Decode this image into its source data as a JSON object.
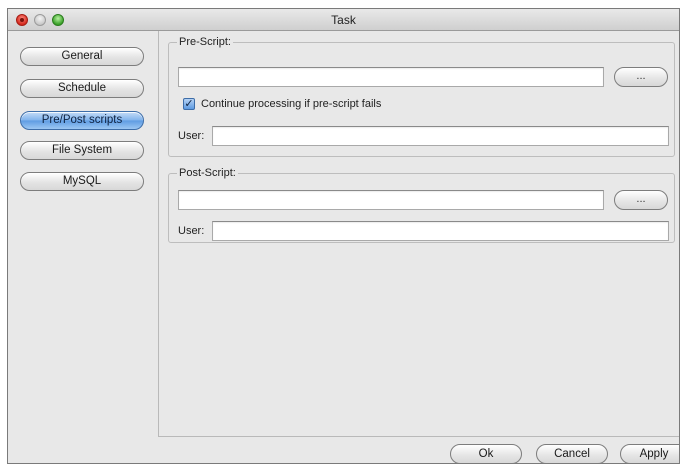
{
  "window": {
    "title": "Task"
  },
  "sidebar": {
    "items": [
      {
        "label": "General",
        "active": false
      },
      {
        "label": "Schedule",
        "active": false
      },
      {
        "label": "Pre/Post scripts",
        "active": true
      },
      {
        "label": "File System",
        "active": false
      },
      {
        "label": "MySQL",
        "active": false
      }
    ]
  },
  "pre_script": {
    "group_title": "Pre-Script:",
    "path_value": "",
    "browse_label": "...",
    "checkbox_label": "Continue processing if pre-script fails",
    "checkbox_checked": true,
    "user_label": "User:",
    "user_value": ""
  },
  "post_script": {
    "group_title": "Post-Script:",
    "path_value": "",
    "browse_label": "...",
    "user_label": "User:",
    "user_value": ""
  },
  "footer": {
    "ok_label": "Ok",
    "cancel_label": "Cancel",
    "apply_label": "Apply"
  },
  "colors": {
    "active_nav": "#7fb2ec",
    "window_bg": "#e8e8e8"
  }
}
